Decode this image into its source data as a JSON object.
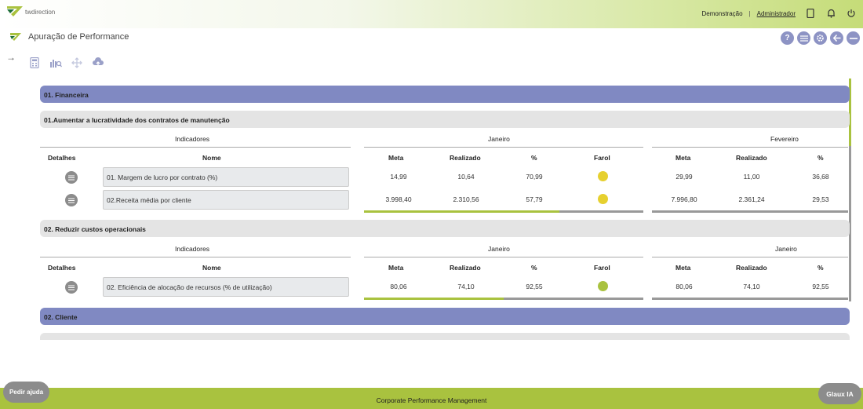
{
  "header": {
    "logo_text": "twdirection",
    "demo_link": "Demonstração",
    "separator": "|",
    "admin_link": "Administrador"
  },
  "page": {
    "title": "Apuração de Performance"
  },
  "icons": {
    "help": "question-icon",
    "list": "list-icon",
    "settings": "gear-icon",
    "back": "arrow-left-icon",
    "minimize": "minus-icon"
  },
  "colors": {
    "accent_green": "#a9c23f",
    "perspective_blue": "#8089c2",
    "farol_yellow": "#e6d02f",
    "farol_green": "#a9c23f"
  },
  "perspectives": [
    {
      "label": "01. Financeira"
    },
    {
      "label": "02. Cliente"
    }
  ],
  "objectives": [
    {
      "title": "01.Aumentar a lucratividade dos contratos de manutenção",
      "indicadores_header": "Indicadores",
      "detalhes_header": "Detalhes",
      "nome_header": "Nome",
      "month1": "Janeiro",
      "month2": "Fevereiro",
      "meta_header": "Meta",
      "realizado_header": "Realizado",
      "pct_header": "%",
      "farol_header": "Farol",
      "progress1": 0.7,
      "progress2": 0.0,
      "rows": [
        {
          "name": "01. Margem de lucro por contrato (%)",
          "meta1": "14,99",
          "real1": "10,64",
          "pct1": "70,99",
          "farol": "#e6d02f",
          "meta2": "29,99",
          "real2": "11,00",
          "pct2": "36,68"
        },
        {
          "name": "02.Receita média por cliente",
          "meta1": "3.998,40",
          "real1": "2.310,56",
          "pct1": "57,79",
          "farol": "#e6d02f",
          "meta2": "7.996,80",
          "real2": "2.361,24",
          "pct2": "29,53"
        }
      ]
    },
    {
      "title": "02. Reduzir custos operacionais",
      "indicadores_header": "Indicadores",
      "detalhes_header": "Detalhes",
      "nome_header": "Nome",
      "month1": "Janeiro",
      "month2": "Janeiro",
      "meta_header": "Meta",
      "realizado_header": "Realizado",
      "pct_header": "%",
      "farol_header": "Farol",
      "progress1": 0.5,
      "progress2": 0.0,
      "rows": [
        {
          "name": "02. Eficiência de alocação de recursos (% de utilização)",
          "meta1": "80,06",
          "real1": "74,10",
          "pct1": "92,55",
          "farol": "#a9c23f",
          "meta2": "80,06",
          "real2": "74,10",
          "pct2": "92,55"
        }
      ]
    }
  ],
  "footer": {
    "text": "Corporate Performance Management",
    "help_button": "Pedir ajuda",
    "ia_button": "Glaux IA"
  }
}
